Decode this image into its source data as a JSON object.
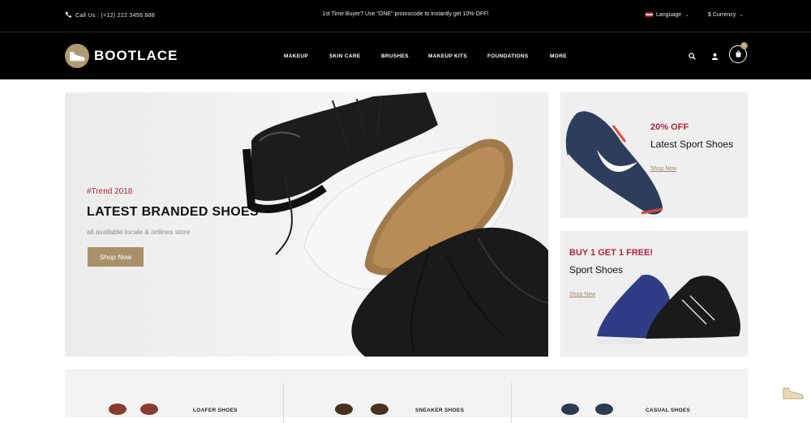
{
  "topbar": {
    "call": "Call Us : (+12) 222 3456 888",
    "promo": "1st Time Buyer? Use \"ONE\" promocode to instantly get 10% OFF!",
    "language": "Language",
    "currency": "$ Currency"
  },
  "header": {
    "brand": "BOOTLACE",
    "nav": [
      "MAKEUP",
      "SKIN CARE",
      "BRUSHES",
      "MAKEUP KITS",
      "FOUNDATIONS",
      "MORE"
    ],
    "cart_count": "0"
  },
  "hero": {
    "tag": "#Trend 2018",
    "title": "LATEST BRANDED SHOES",
    "subtitle": "all available locale & onlines store",
    "button": "Shop Now"
  },
  "banner1": {
    "highlight": "20% OFF",
    "text": "Latest Sport Shoes",
    "link": "Shop Now"
  },
  "banner2": {
    "highlight": "BUY 1 GET 1 FREE!",
    "text": "Sport Shoes",
    "link": "Shop Now"
  },
  "categories": [
    "LOAFER SHOES",
    "SNEAKER SHOES",
    "CASUAL SHOES"
  ],
  "colors": {
    "accent": "#a8916a",
    "highlight": "#b0263b",
    "header_bg": "#000000"
  }
}
